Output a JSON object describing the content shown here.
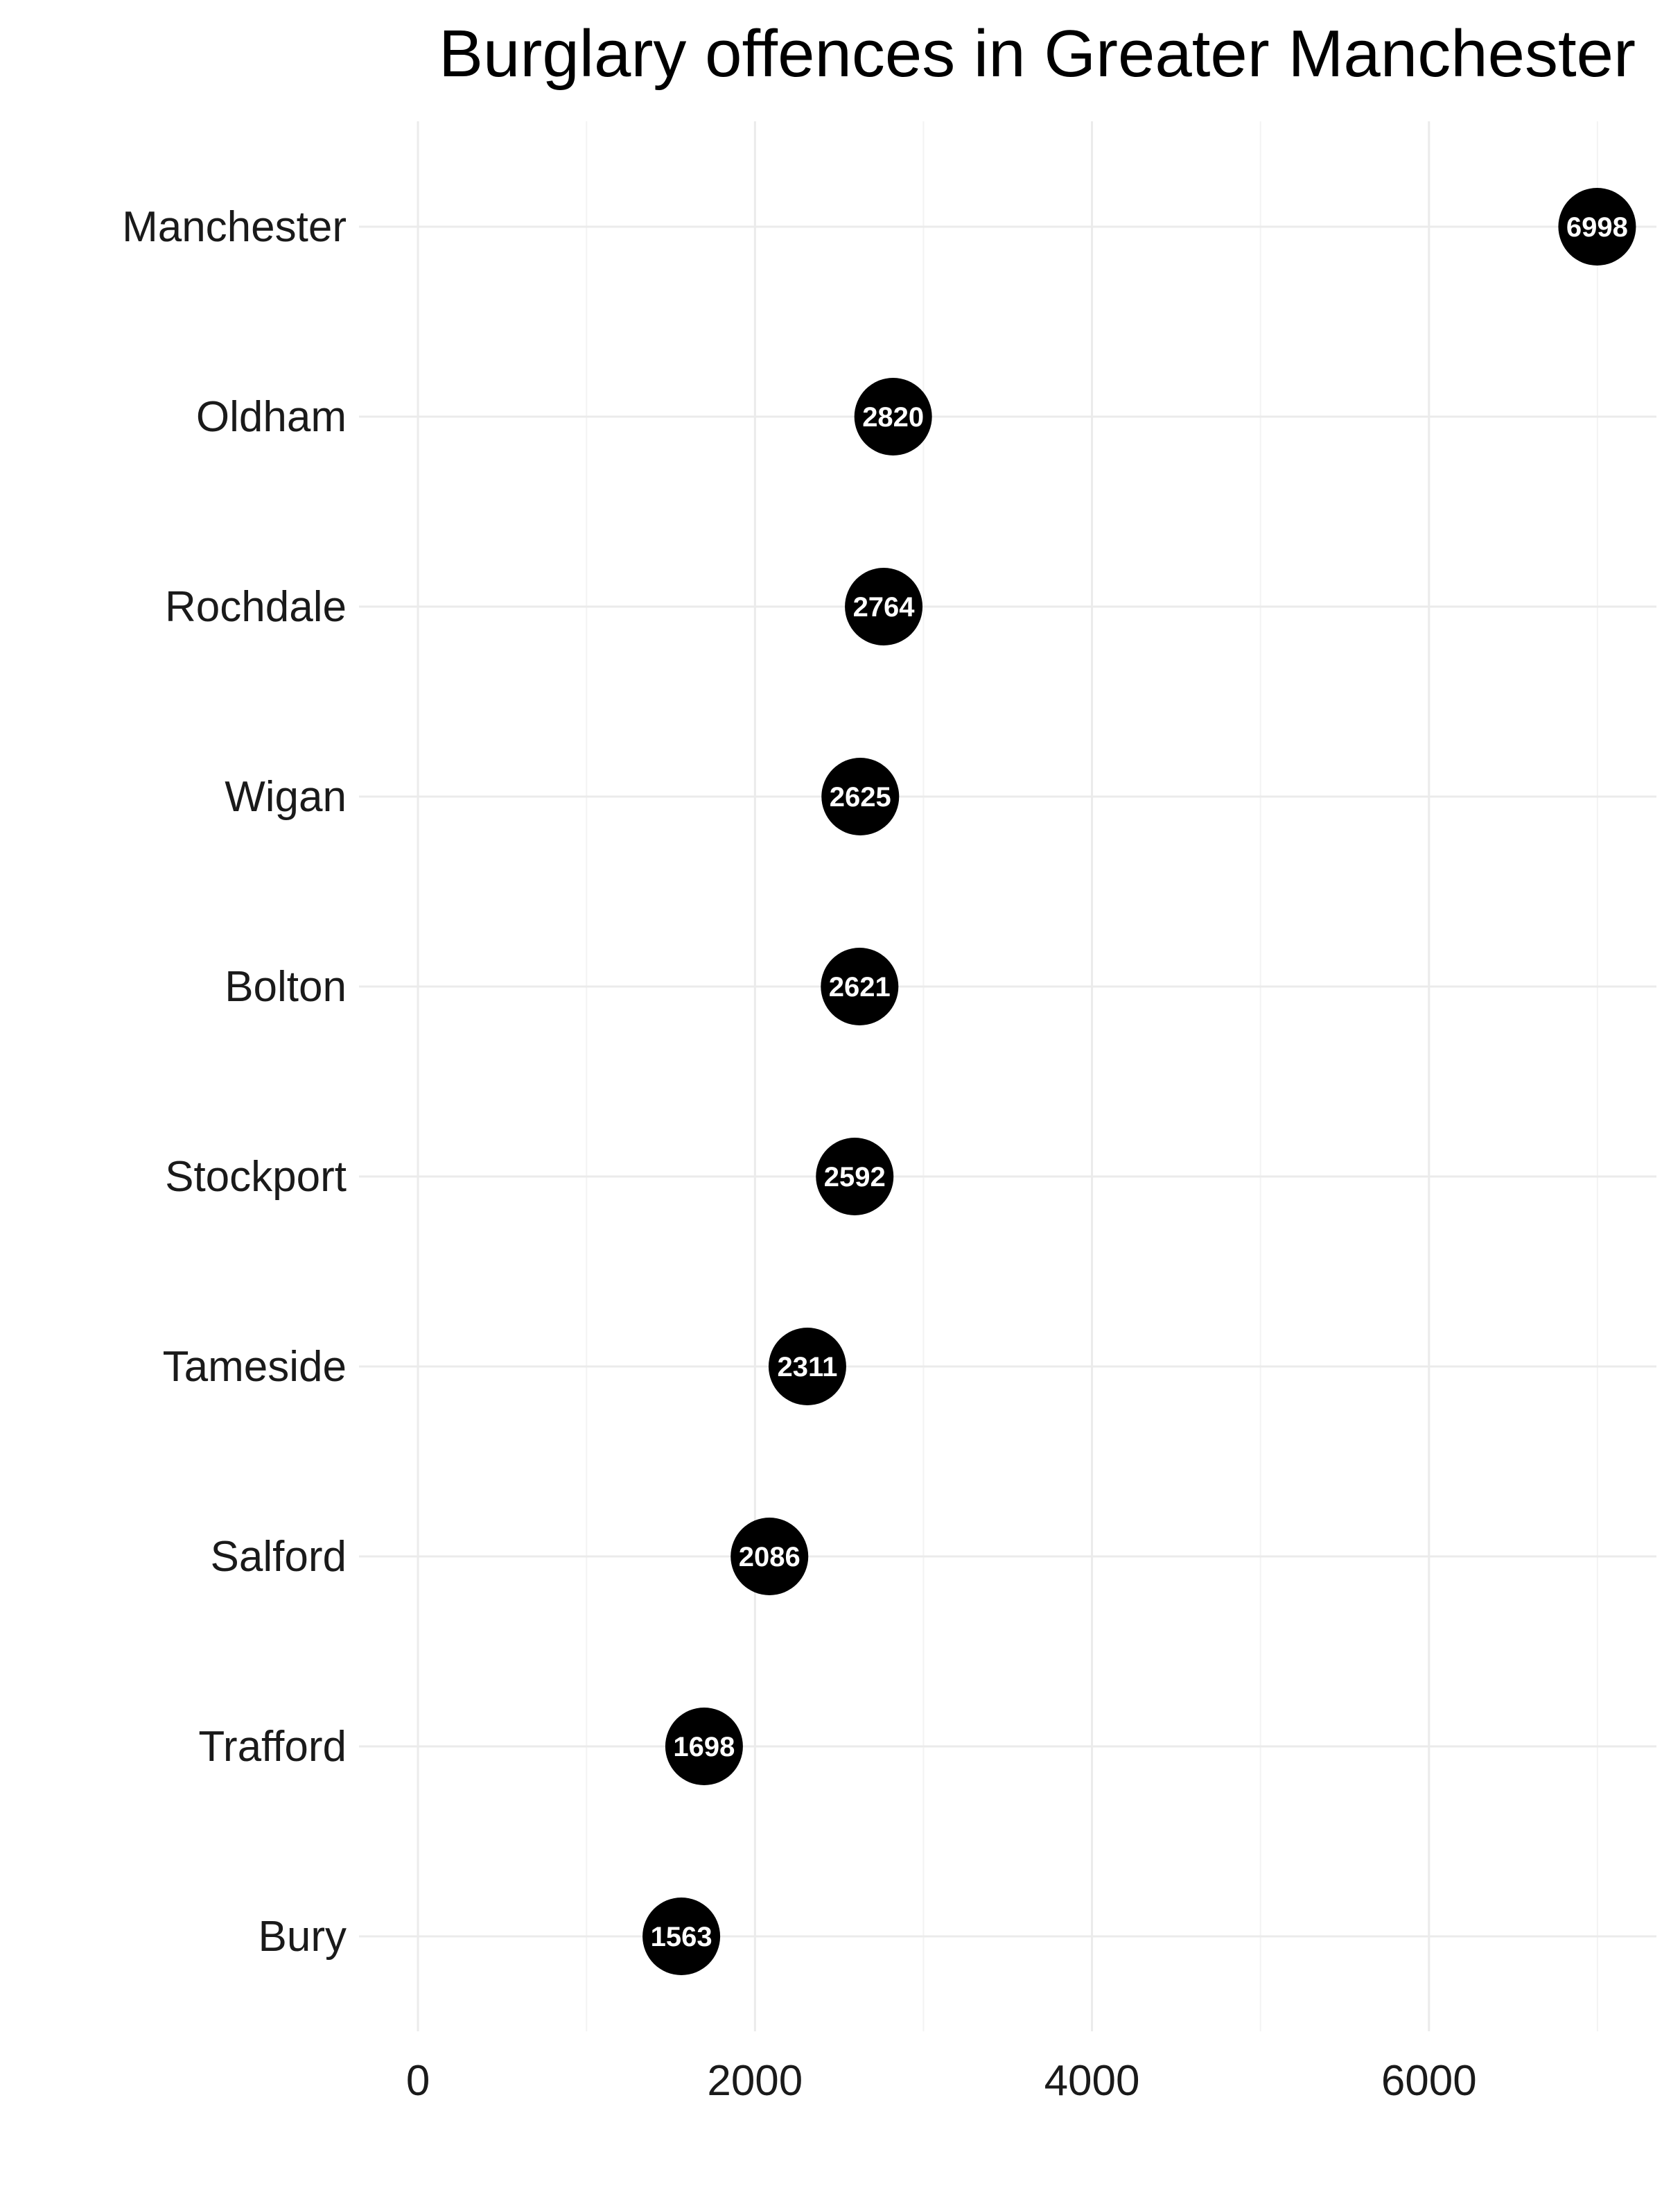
{
  "chart_data": {
    "type": "dot",
    "title": "Burglary offences in Greater Manchester",
    "xlabel": "",
    "ylabel": "",
    "categories": [
      "Manchester",
      "Oldham",
      "Rochdale",
      "Wigan",
      "Bolton",
      "Stockport",
      "Tameside",
      "Salford",
      "Trafford",
      "Bury"
    ],
    "values": [
      6998,
      2820,
      2764,
      2625,
      2621,
      2592,
      2311,
      2086,
      1698,
      1563
    ],
    "xlim": [
      -350,
      7350
    ],
    "xticks": [
      0,
      2000,
      4000,
      6000
    ],
    "xtick_labels": [
      "0",
      "2000",
      "4000",
      "6000"
    ],
    "minor_xticks": [
      1000,
      3000,
      5000,
      7000
    ],
    "grid": true,
    "point_color": "#000000",
    "label_color": "#ffffff"
  }
}
